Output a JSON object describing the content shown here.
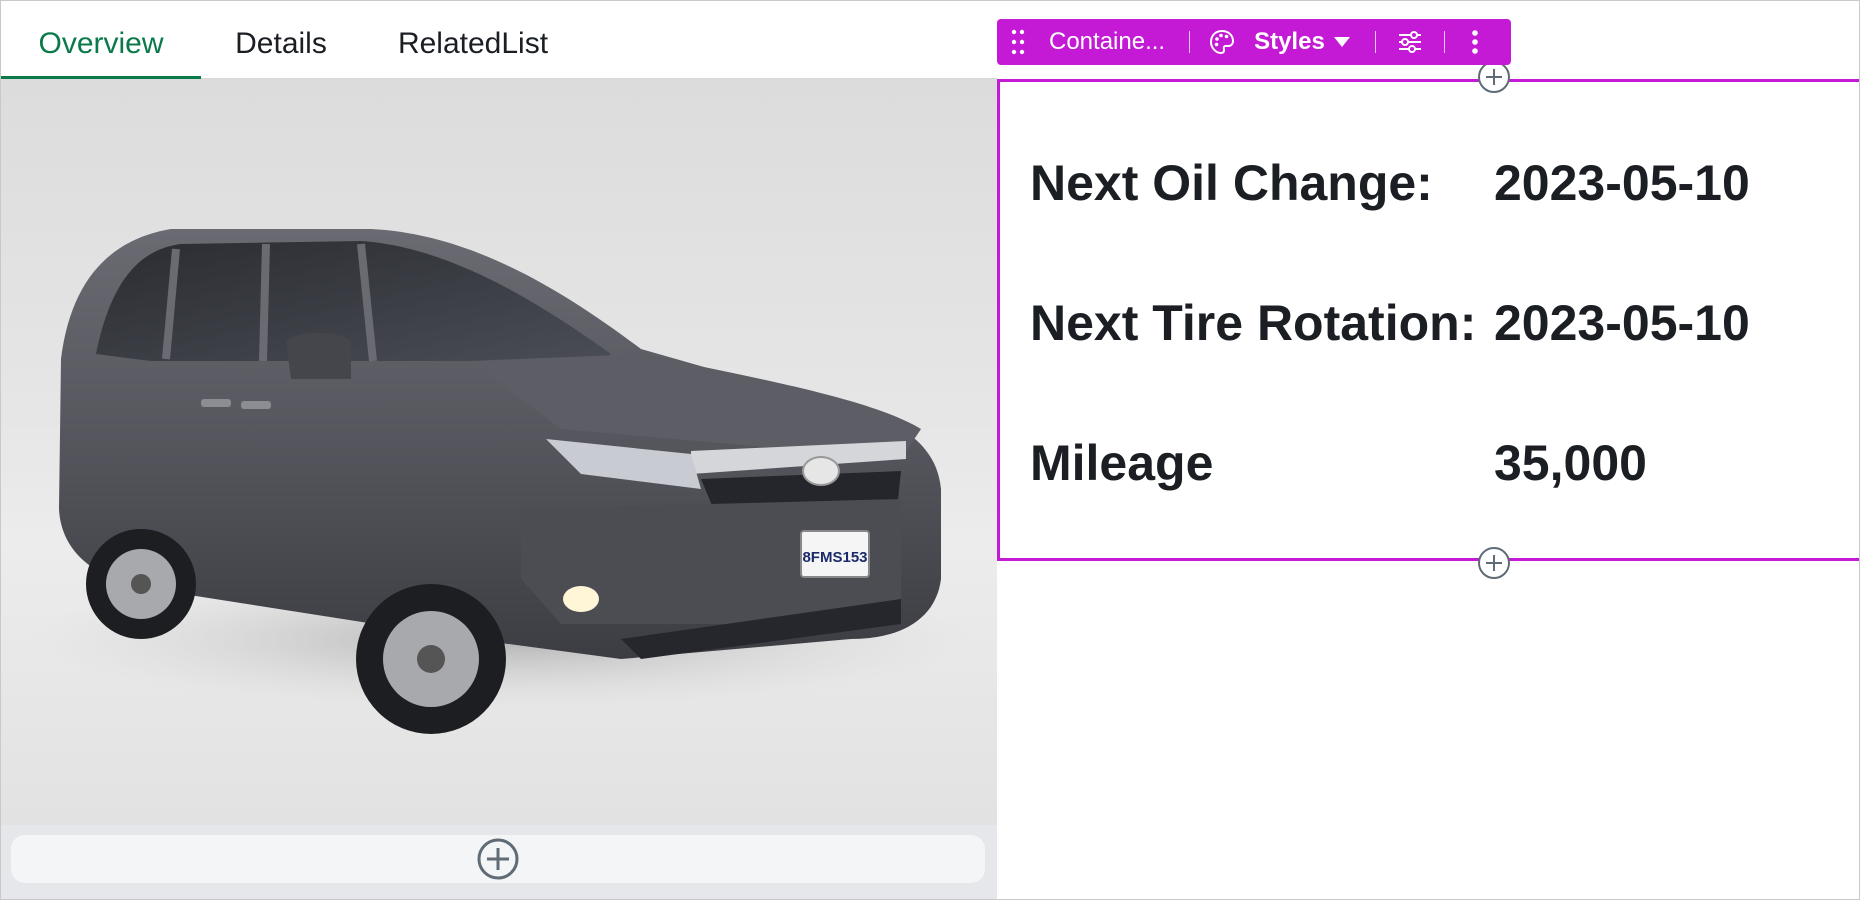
{
  "tabs": [
    {
      "label": "Overview",
      "active": true
    },
    {
      "label": "Details",
      "active": false
    },
    {
      "label": "RelatedList",
      "active": false
    }
  ],
  "toolbar": {
    "drag_icon": "drag-handle-icon",
    "container_label": "Containe...",
    "palette_icon": "palette-icon",
    "styles_label": "Styles",
    "dropdown_icon": "caret-down-icon",
    "settings_icon": "sliders-icon",
    "more_icon": "more-vertical-icon",
    "accent_color": "#c41ad6"
  },
  "fields": [
    {
      "label": "Next Oil Change:",
      "value": "2023-05-10"
    },
    {
      "label": "Next Tire Rotation:",
      "value": "2023-05-10"
    },
    {
      "label": "Mileage",
      "value": "35,000"
    }
  ],
  "image": {
    "subject": "vehicle-photo",
    "plate_text": "8FMS153"
  },
  "colors": {
    "active_tab": "#0b7a4b",
    "text": "#1b1f24",
    "selection": "#c41ad6"
  }
}
